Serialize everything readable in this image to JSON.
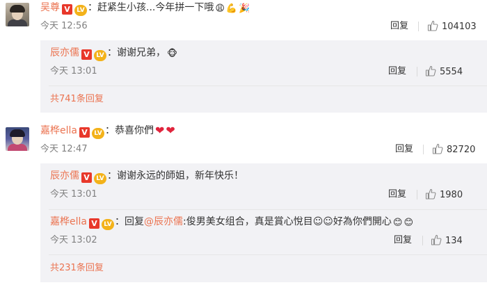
{
  "comments": [
    {
      "user": "吴尊",
      "v_badge": "V",
      "level_badge": "LV",
      "text": "：赶紧生小孩...今年拼一下哦",
      "emojis": [
        "😩",
        "💪",
        "🎉"
      ],
      "time": "今天 12:56",
      "reply_label": "回复",
      "likes": "104103",
      "replies": [
        {
          "user": "辰亦儒",
          "v_badge": "V",
          "level_badge": "LV",
          "text": "：谢谢兄弟，",
          "emojis": [
            "🐵"
          ],
          "time": "今天 13:01",
          "reply_label": "回复",
          "likes": "5554"
        }
      ],
      "more_replies": "共741条回复"
    },
    {
      "user": "嘉桦ella",
      "v_badge": "V",
      "level_badge": "LV",
      "text": "：恭喜你們",
      "emojis": [
        "❤",
        "❤"
      ],
      "time": "今天 12:47",
      "reply_label": "回复",
      "likes": "82720",
      "replies": [
        {
          "user": "辰亦儒",
          "v_badge": "V",
          "level_badge": "LV",
          "text": "：谢谢永远的師姐，新年快乐！",
          "emojis": [],
          "time": "今天 13:01",
          "reply_label": "回复",
          "likes": "1980"
        },
        {
          "user": "嘉桦ella",
          "v_badge": "V",
          "level_badge": "LV",
          "text_prefix": "：回复",
          "mention": "@辰亦儒",
          "text": ":俊男美女组合，真是賞心悅目☺☺好為你們開心",
          "emojis": [
            "😊",
            "😊"
          ],
          "time": "今天 13:02",
          "reply_label": "回复",
          "likes": "134"
        }
      ],
      "more_replies": "共231条回复"
    }
  ],
  "colors": {
    "username": "#eb7350",
    "subbox_bg": "#f2f2f5",
    "v_badge": "#e8382b",
    "level_badge": "#f3b21a"
  },
  "icons": {
    "like": "thumbs-up-icon"
  }
}
